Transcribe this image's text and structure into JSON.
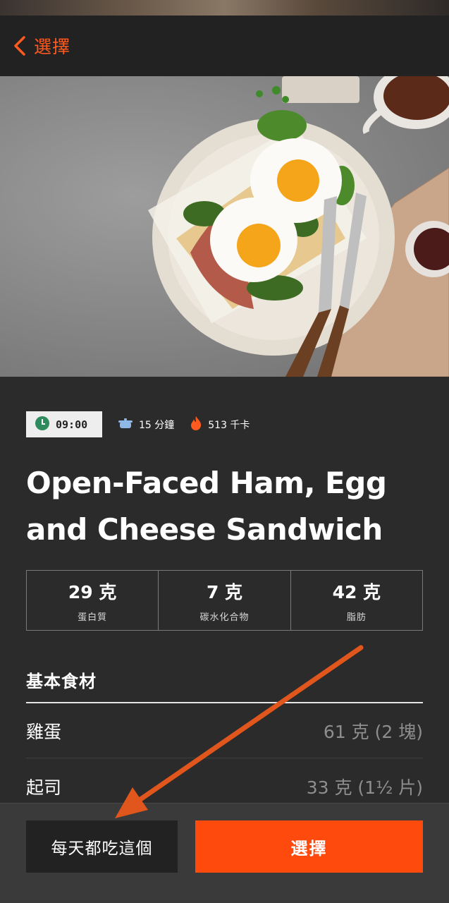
{
  "header": {
    "back_label": "選擇"
  },
  "hero": {
    "image_description": ""
  },
  "meta": {
    "time": "09:00",
    "duration": "15 分鐘",
    "calories": "513 千卡"
  },
  "recipe": {
    "title_line1": "Open-Faced Ham, Egg",
    "title_line2": "and Cheese Sandwich"
  },
  "macros": [
    {
      "value": "29 克",
      "label": "蛋白質"
    },
    {
      "value": "7 克",
      "label": "碳水化合物"
    },
    {
      "value": "42 克",
      "label": "脂肪"
    }
  ],
  "ingredients_section": {
    "title": "基本食材",
    "items": [
      {
        "name": "雞蛋",
        "qty": "61 克 (2 塊)"
      },
      {
        "name": "起司",
        "qty": "33 克 (1½ 片)"
      }
    ]
  },
  "actions": {
    "daily_label": "每天都吃這個",
    "select_label": "選擇"
  },
  "colors": {
    "accent": "#ff4a0e",
    "back": "#ff5a1f",
    "background": "#2b2b2b",
    "arrow": "#e0561c"
  }
}
